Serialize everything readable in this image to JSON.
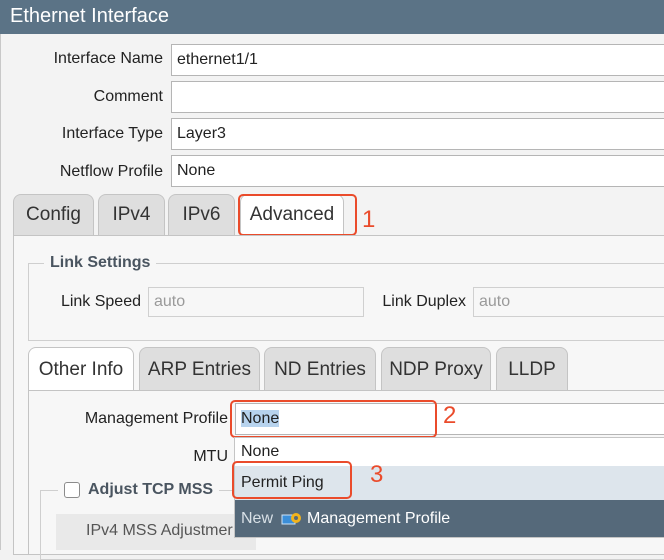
{
  "window": {
    "title": "Ethernet Interface"
  },
  "general": {
    "interface_name_label": "Interface Name",
    "interface_name_value": "ethernet1/1",
    "comment_label": "Comment",
    "comment_value": "",
    "interface_type_label": "Interface Type",
    "interface_type_value": "Layer3",
    "netflow_profile_label": "Netflow Profile",
    "netflow_profile_value": "None"
  },
  "tabs": [
    {
      "label": "Config",
      "active": false
    },
    {
      "label": "IPv4",
      "active": false
    },
    {
      "label": "IPv6",
      "active": false
    },
    {
      "label": "Advanced",
      "active": true
    }
  ],
  "link_settings": {
    "legend": "Link Settings",
    "speed_label": "Link Speed",
    "speed_placeholder": "auto",
    "duplex_label": "Link Duplex",
    "duplex_placeholder": "auto"
  },
  "subtabs": [
    {
      "label": "Other Info",
      "active": true
    },
    {
      "label": "ARP Entries",
      "active": false
    },
    {
      "label": "ND Entries",
      "active": false
    },
    {
      "label": "NDP Proxy",
      "active": false
    },
    {
      "label": "LLDP",
      "active": false
    }
  ],
  "other_info": {
    "management_profile_label": "Management Profile",
    "management_profile_value": "None",
    "mtu_label": "MTU",
    "adjust_tcp_mss_label": "Adjust TCP MSS",
    "adjust_tcp_mss_checked": false,
    "ipv4_mss_label": "IPv4 MSS Adjustmer"
  },
  "dropdown": {
    "options": [
      {
        "label": "None",
        "selected": false
      },
      {
        "label": "Permit Ping",
        "selected": true
      }
    ],
    "new_label": "New",
    "new_item_label": "Management Profile"
  },
  "annotations": [
    "1",
    "2",
    "3"
  ],
  "colors": {
    "titlebar": "#5b7386",
    "callout": "#ea4b2b",
    "dropdown_footer": "#55697a"
  }
}
